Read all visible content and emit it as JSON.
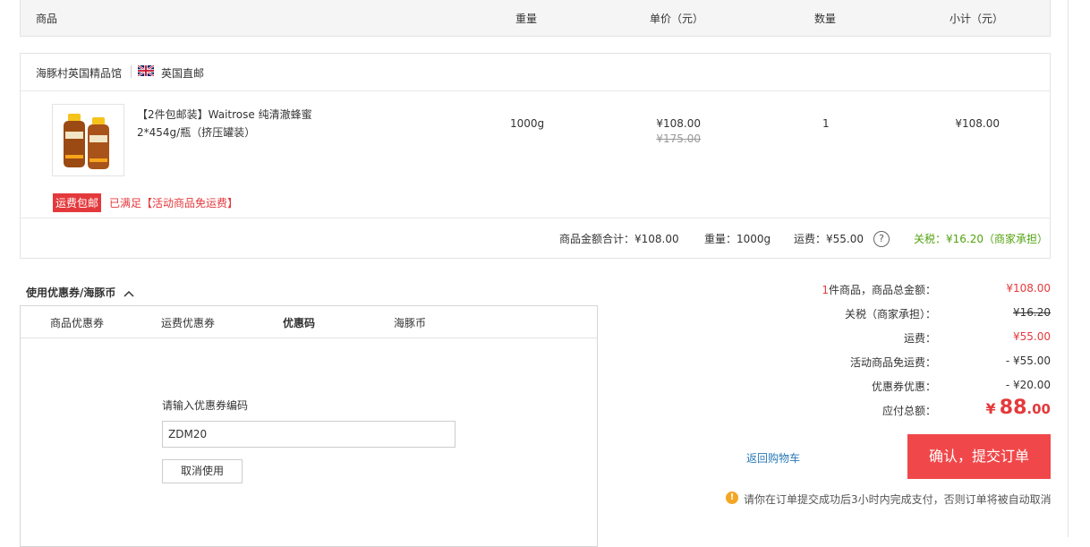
{
  "table_header": {
    "product": "商品",
    "weight": "重量",
    "unit_price": "单价（元）",
    "quantity": "数量",
    "subtotal": "小计（元）"
  },
  "store": {
    "name": "海豚村英国精品馆",
    "shipping_tag": "英国直邮"
  },
  "item": {
    "name": "【2件包邮装】Waitrose 纯清澈蜂蜜 2*454g/瓶（挤压罐装）",
    "weight": "1000g",
    "unit_price": "¥108.00",
    "original_price": "¥175.00",
    "quantity": "1",
    "subtotal": "¥108.00",
    "badge": "运费包邮",
    "promo": "已满足【活动商品免运费】"
  },
  "order_summary": {
    "goods_total": "商品金额合计：¥108.00",
    "weight": "重量：1000g",
    "shipping": "运费：¥55.00",
    "help": "?",
    "tax": "关税：¥16.20（商家承担）"
  },
  "coupon": {
    "title": "使用优惠券/海豚币",
    "tabs": [
      "商品优惠券",
      "运费优惠券",
      "优惠码",
      "海豚币"
    ],
    "input_label": "请输入优惠券编码",
    "input_value": "ZDM20",
    "cancel_label": "取消使用"
  },
  "totals": {
    "goods_count_prefix": "1",
    "goods_label": "件商品，商品总金额：",
    "goods_value": "¥108.00",
    "tax_label": "关税（商家承担）：",
    "tax_value": "¥16.20",
    "shipping_label": "运费：",
    "shipping_value": "¥55.00",
    "free_shipping_label": "活动商品免运费：",
    "free_shipping_value": "- ¥55.00",
    "coupon_label": "优惠券优惠：",
    "coupon_value": "- ¥20.00",
    "payable_label": "应付总额：",
    "payable_currency": "¥",
    "payable_int": "88",
    "payable_dec": ".00"
  },
  "actions": {
    "back_to_cart": "返回购物车",
    "submit": "确认，提交订单",
    "notice_icon": "!",
    "notice": "请你在订单提交成功后3小时内完成支付，否则订单将被自动取消"
  },
  "colors": {
    "accent_red": "#e4393c",
    "submit_bg": "#f0484a",
    "tax_green": "#52a30f",
    "link_blue": "#2a7ab8"
  }
}
